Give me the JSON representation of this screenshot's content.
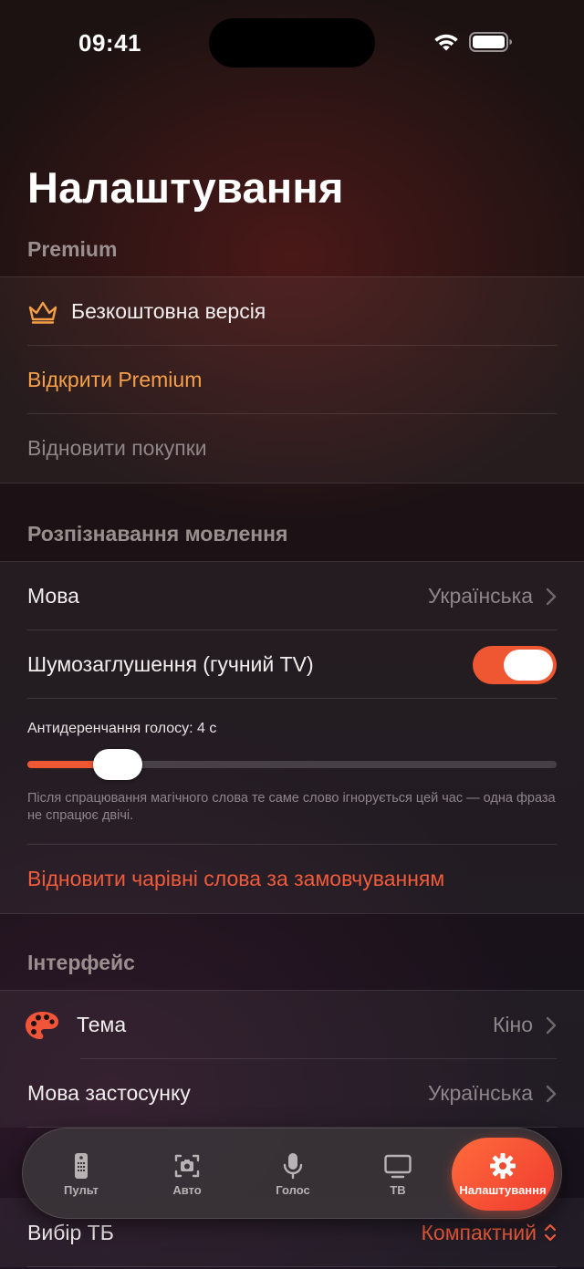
{
  "status_bar": {
    "time": "09:41"
  },
  "page_title": "Налаштування",
  "premium": {
    "header": "Premium",
    "free_version": "Безкоштовна версія",
    "open_premium": "Відкрити Premium",
    "restore_purchases": "Відновити покупки"
  },
  "speech": {
    "header": "Розпізнавання мовлення",
    "language_label": "Мова",
    "language_value": "Українська",
    "noise_label": "Шумозаглушення (гучний TV)",
    "noise_on": true,
    "debounce_label": "Антидеренчання голосу: 4 с",
    "debounce_level": 0.17,
    "debounce_note": "Після спрацювання магічного слова те саме слово ігнорується цей час — одна фраза не спрацює двічі.",
    "reset_magic_words": "Відновити чарівні слова за замовчуванням"
  },
  "interface": {
    "header": "Інтерфейс",
    "theme_label": "Тема",
    "theme_value": "Кіно",
    "app_language_label": "Мова застосунку",
    "app_language_value": "Українська",
    "tv_choice_label": "Вибір ТБ",
    "tv_choice_value": "Компактний"
  },
  "tabs": [
    {
      "label": "Пульт",
      "icon": "remote-icon"
    },
    {
      "label": "Авто",
      "icon": "camera-scan-icon"
    },
    {
      "label": "Голос",
      "icon": "microphone-icon"
    },
    {
      "label": "ТВ",
      "icon": "tv-icon"
    },
    {
      "label": "Налаштування",
      "icon": "gear-icon",
      "active": true
    }
  ],
  "colors": {
    "accent": "#ef5733",
    "premium_orange": "#f5a049",
    "reset_coral": "#ef5b3b"
  }
}
